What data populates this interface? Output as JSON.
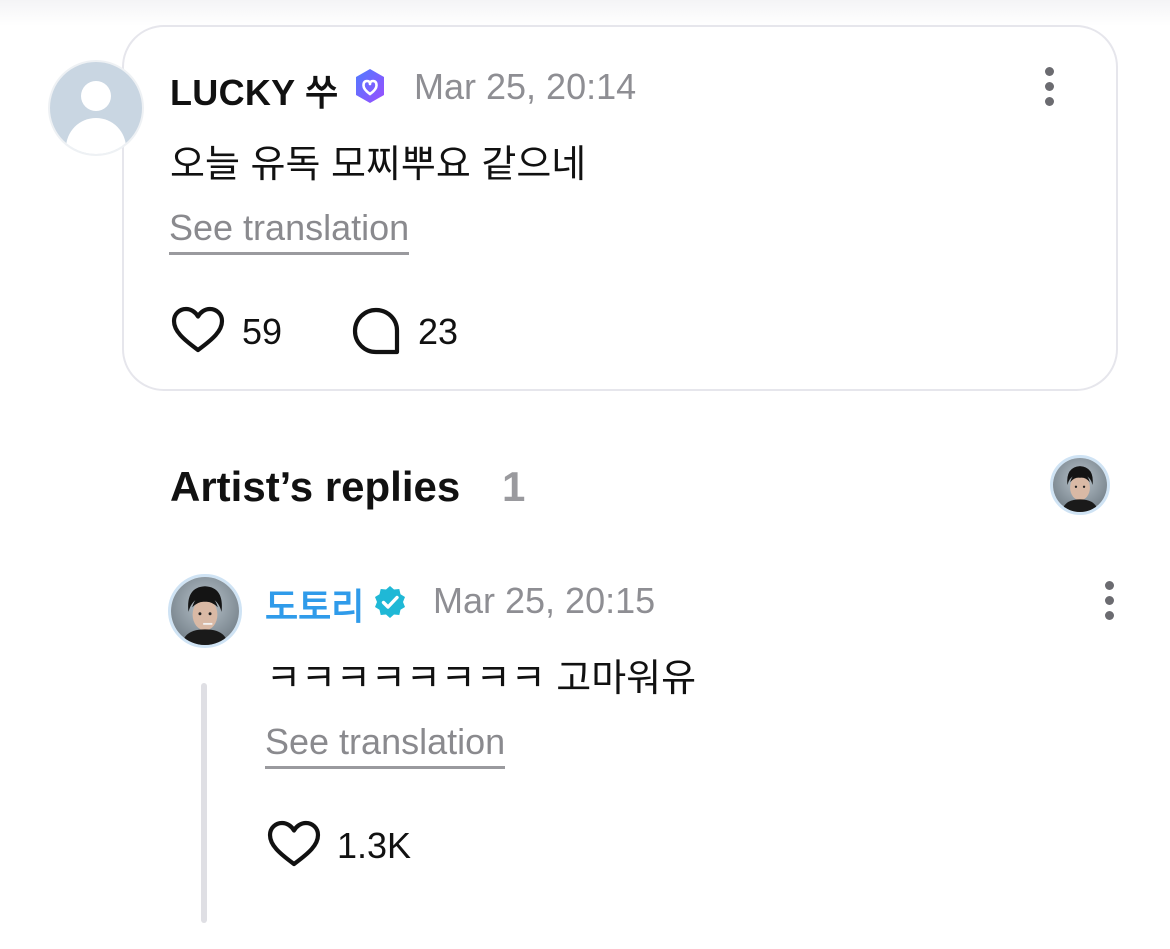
{
  "comment": {
    "username": "LUCKY 쑤",
    "timestamp": "Mar 25, 20:14",
    "text": "오늘 유독 모찌뿌요 같으네",
    "see_translation": "See translation",
    "likes": "59",
    "replies": "23",
    "badge_color": "#6b5cf0"
  },
  "artist_replies": {
    "title": "Artist’s replies",
    "count": "1",
    "reply": {
      "username": "도토리",
      "timestamp": "Mar 25, 20:15",
      "text": "ㅋㅋㅋㅋㅋㅋㅋㅋ 고마워유",
      "see_translation": "See translation",
      "likes": "1.3K",
      "name_color": "#2f9bea",
      "badge_color": "#1fb8d6"
    }
  },
  "icons": {
    "like": "heart-icon",
    "reply": "speech-bubble-icon",
    "more": "more-vertical-icon",
    "verified_fan": "verified-badge-icon",
    "verified_artist": "verified-badge-icon"
  }
}
